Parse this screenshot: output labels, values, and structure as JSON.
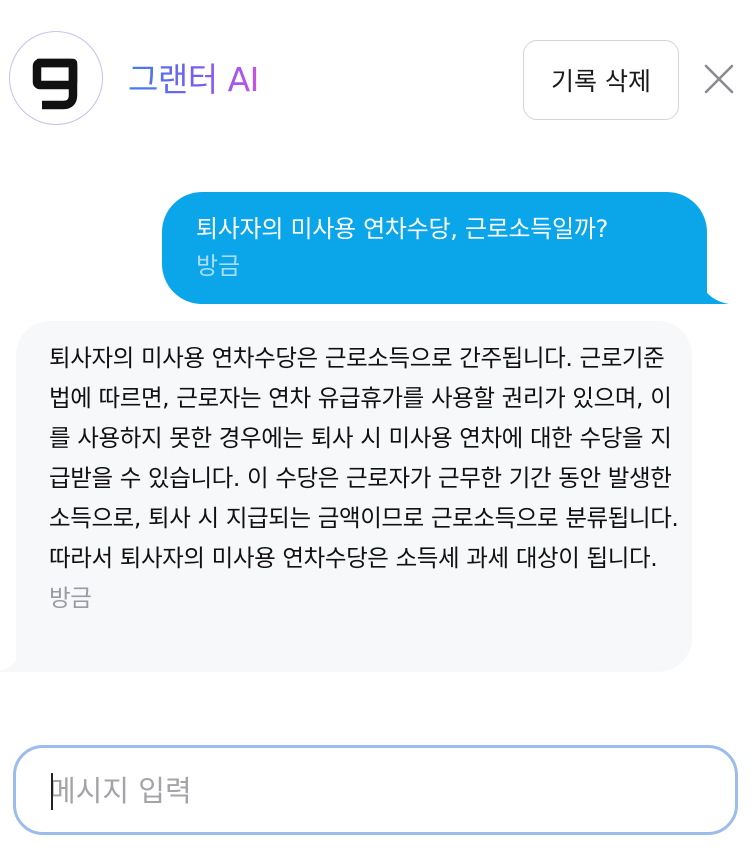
{
  "header": {
    "logo_icon": "g-logo-icon",
    "title": "그랜터 AI",
    "clear_button_label": "기록 삭제",
    "close_icon": "close-icon"
  },
  "messages": [
    {
      "role": "user",
      "text": "퇴사자의 미사용 연차수당, 근로소득일까?",
      "time": "방금"
    },
    {
      "role": "assistant",
      "text": "퇴사자의 미사용 연차수당은 근로소득으로 간주됩니다. 근로기준법에 따르면, 근로자는 연차 유급휴가를 사용할 권리가 있으며, 이를 사용하지 못한 경우에는 퇴사 시 미사용 연차에 대한 수당을 지급받을 수 있습니다. 이 수당은 근로자가 근무한 기간 동안 발생한 소득으로, 퇴사 시 지급되는 금액이므로 근로소득으로 분류됩니다. 따라서 퇴사자의 미사용 연차수당은 소득세 과세 대상이 됩니다.",
      "time": "방금"
    }
  ],
  "input": {
    "placeholder": "메시지 입력",
    "value": ""
  },
  "colors": {
    "user_bubble": "#0ba6ea",
    "bot_bubble": "#f7f8fa",
    "input_border": "#9cbcec",
    "title_gradient_start": "#3f7ef0",
    "title_gradient_end": "#c453e8"
  }
}
